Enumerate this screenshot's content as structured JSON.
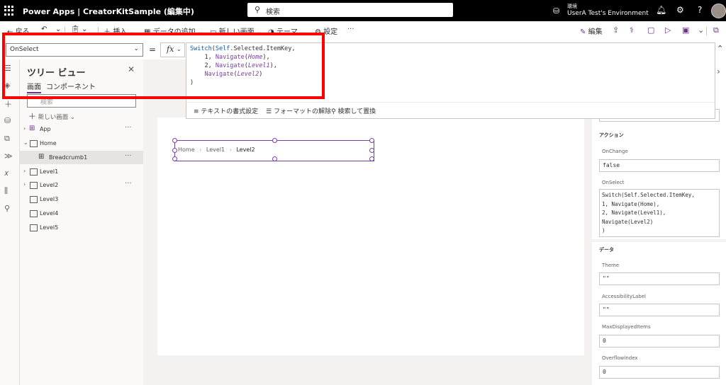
{
  "topbar": {
    "app_title": "Power Apps | CreatorKitSample (編集中)",
    "search_placeholder": "検索",
    "env_label": "環境",
    "env_name": "UserA Test's Environment"
  },
  "commandbar": {
    "back": "戻る",
    "insert": "挿入",
    "add_data": "データの追加",
    "new_screen": "新しい画面",
    "theme": "テーマ",
    "settings": "設定",
    "more": "···",
    "edit": "編集"
  },
  "formulabar": {
    "property": "OnSelect",
    "equals": "=",
    "fx": "fx"
  },
  "editor": {
    "toolbar": {
      "format": "テキストの書式設定",
      "remove_format": "フォーマットの解除",
      "find_replace": "検索して置換"
    }
  },
  "tree": {
    "title": "ツリー ビュー",
    "tab_screens": "画面",
    "tab_components": "コンポーネント",
    "search_placeholder": "検索",
    "new_screen": "新しい画面",
    "items": [
      {
        "label": "App"
      },
      {
        "label": "Home"
      },
      {
        "label": "Breadcrumb1"
      },
      {
        "label": "Level1"
      },
      {
        "label": "Level2"
      },
      {
        "label": "Level3"
      },
      {
        "label": "Level4"
      },
      {
        "label": "Level5"
      }
    ]
  },
  "canvas": {
    "breadcrumb": {
      "home": "Home",
      "level1": "Level1",
      "level2": "Level2"
    }
  },
  "properties": {
    "section_action": "アクション",
    "onchange_label": "OnChange",
    "onchange_value": "false",
    "onselect_label": "OnSelect",
    "onselect_lines": [
      "Switch(Self.Selected.ItemKey,",
      "1, Navigate(Home),",
      "2, Navigate(Level1),",
      "Navigate(Level2)",
      ")"
    ],
    "section_data": "データ",
    "theme_label": "Theme",
    "theme_value": "\"\"",
    "accessibility_label": "AccessibilityLabel",
    "accessibility_value": "\"\"",
    "maxdisplayed_label": "MaxDisplayedItems",
    "maxdisplayed_value": "0",
    "overflow_label": "OverflowIndex",
    "overflow_value": "0"
  },
  "colors": {
    "accent": "#6b2f8a",
    "highlight": "#ff0000",
    "keyword": "#0c5bb3"
  }
}
